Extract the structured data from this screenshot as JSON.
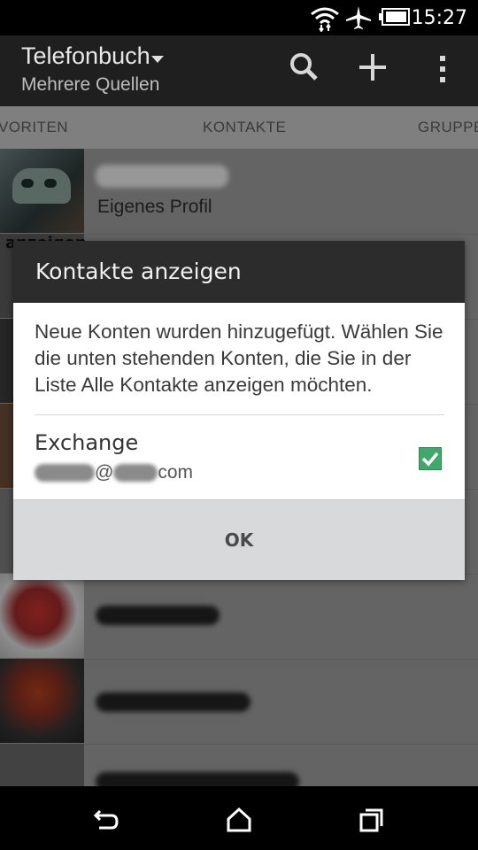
{
  "status_bar": {
    "time": "15:27"
  },
  "app_bar": {
    "title": "Telefonbuch",
    "subtitle": "Mehrere Quellen"
  },
  "tabs": [
    {
      "label": "VORITEN"
    },
    {
      "label": "KONTAKTE"
    },
    {
      "label": "GRUPPE"
    }
  ],
  "list": {
    "profile_label": "Eigenes Profil",
    "partial_text": "anzeigen"
  },
  "dialog": {
    "title": "Kontakte anzeigen",
    "message": "Neue Konten wurden hinzugefügt. Wählen Sie die unten stehenden Konten, die Sie in der Liste Alle Kontakte anzeigen möchten.",
    "account": {
      "name": "Exchange",
      "email_at": "@",
      "email_suffix": "com",
      "checked": true
    },
    "ok_label": "OK"
  },
  "colors": {
    "accent_check": "#3ea96b",
    "dialog_header": "#2c2c2c",
    "app_bar": "#1f1f1f"
  },
  "icons": [
    "wifi-icon",
    "airplane-mode-icon",
    "battery-icon",
    "dropdown-caret-icon",
    "search-icon",
    "add-icon",
    "overflow-menu-icon",
    "check-icon",
    "back-icon",
    "home-icon",
    "recent-apps-icon"
  ]
}
